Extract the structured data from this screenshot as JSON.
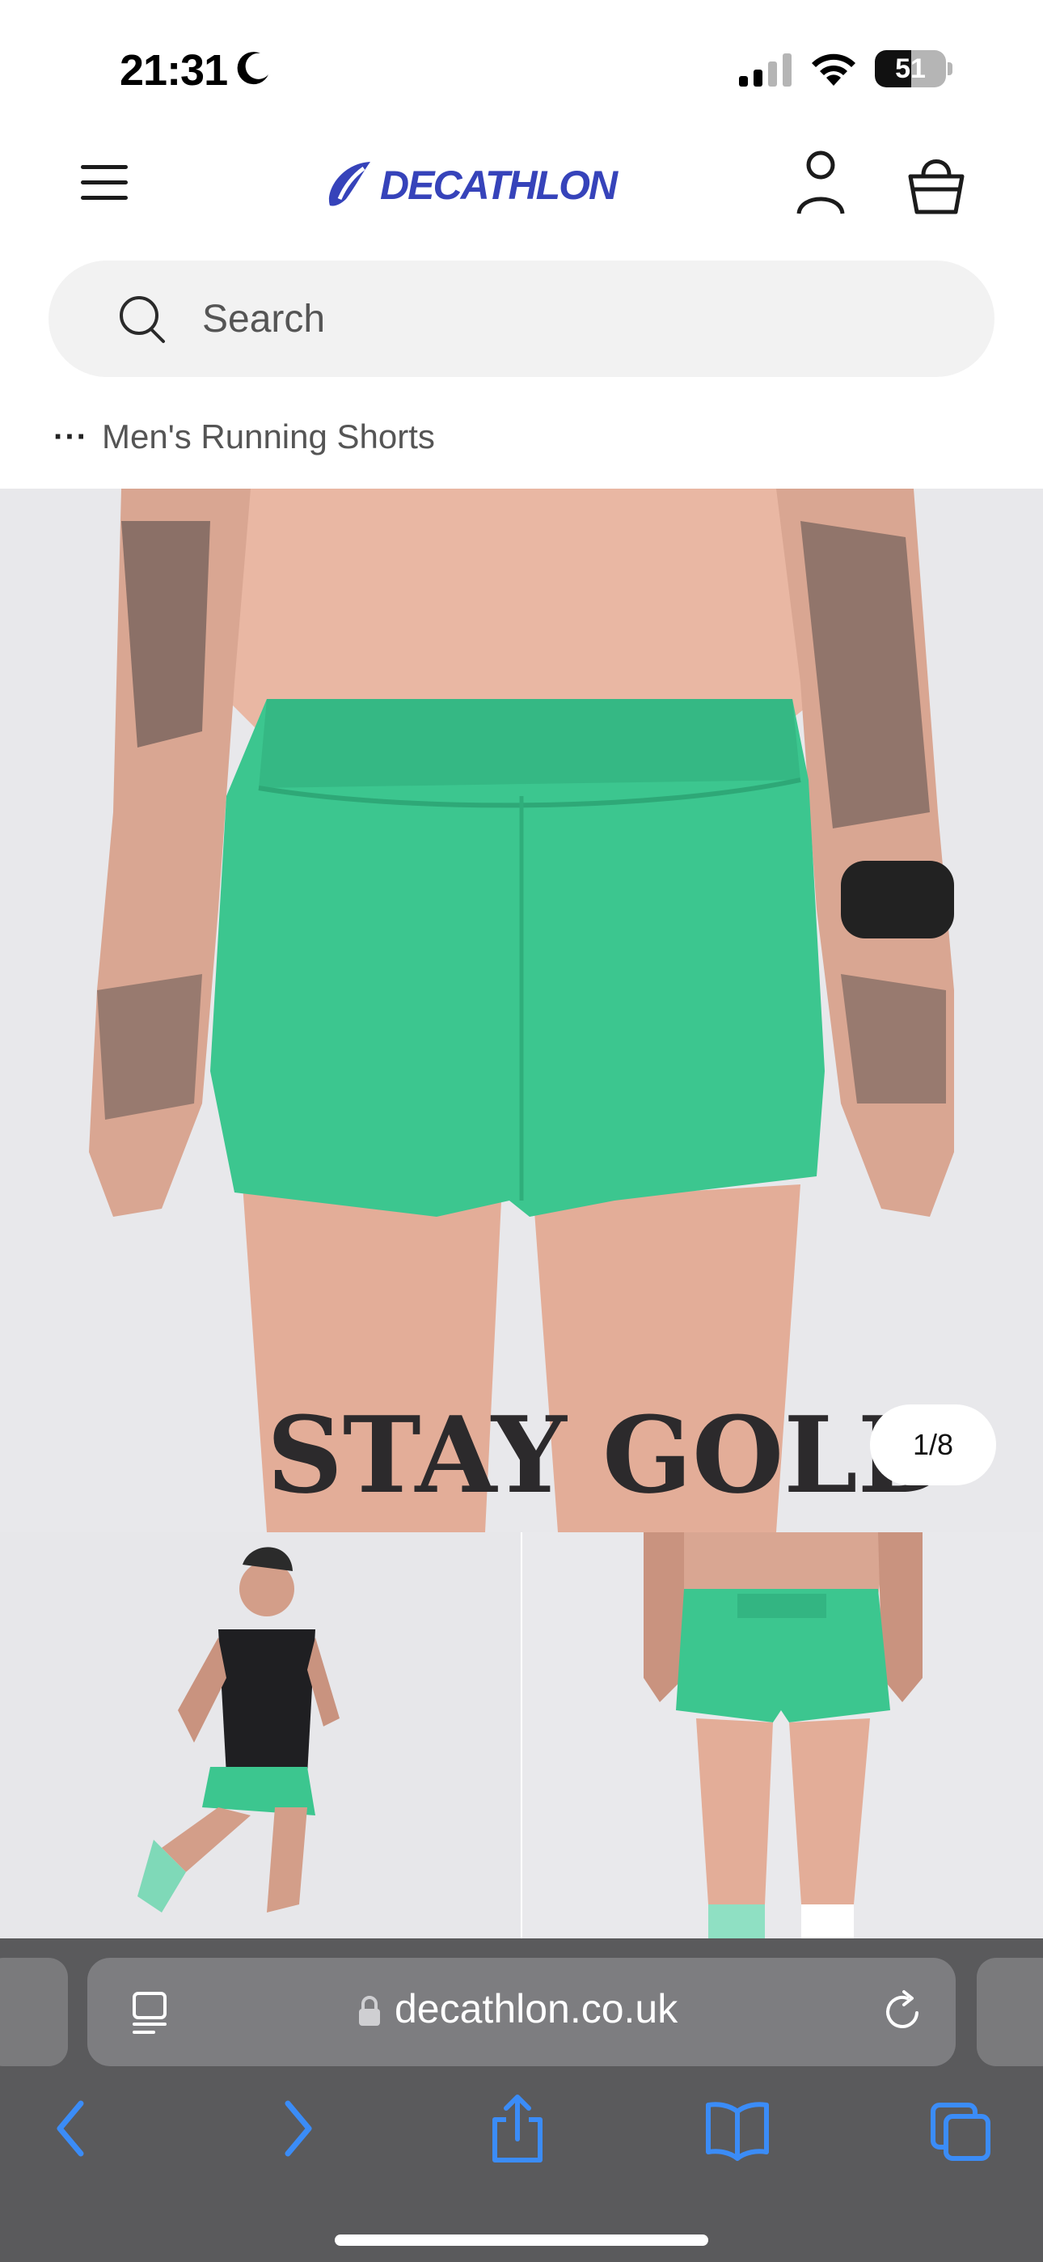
{
  "status_bar": {
    "time": "21:31",
    "battery_level": "51",
    "battery_fraction": 0.51,
    "icons": [
      "moon-icon",
      "signal-icon",
      "wifi-icon",
      "battery-icon"
    ]
  },
  "header": {
    "logo_text": "DECATHLON",
    "brand_color": "#3643ba",
    "icons": [
      "menu-icon",
      "account-icon",
      "basket-icon"
    ]
  },
  "search": {
    "placeholder": "Search",
    "value": ""
  },
  "breadcrumb": {
    "ellipsis": "···",
    "label": "Men's Running Shorts"
  },
  "gallery": {
    "counter": "1/8",
    "main_text_left": "STAY",
    "main_text_right": "GOLD",
    "product_color": "#3cc68f"
  },
  "browser": {
    "url": "decathlon.co.uk",
    "icons": [
      "reader-icon",
      "lock-icon",
      "reload-icon",
      "back-icon",
      "forward-icon",
      "share-icon",
      "bookmarks-icon",
      "tabs-icon"
    ],
    "accent_color": "#3b8cf7"
  }
}
